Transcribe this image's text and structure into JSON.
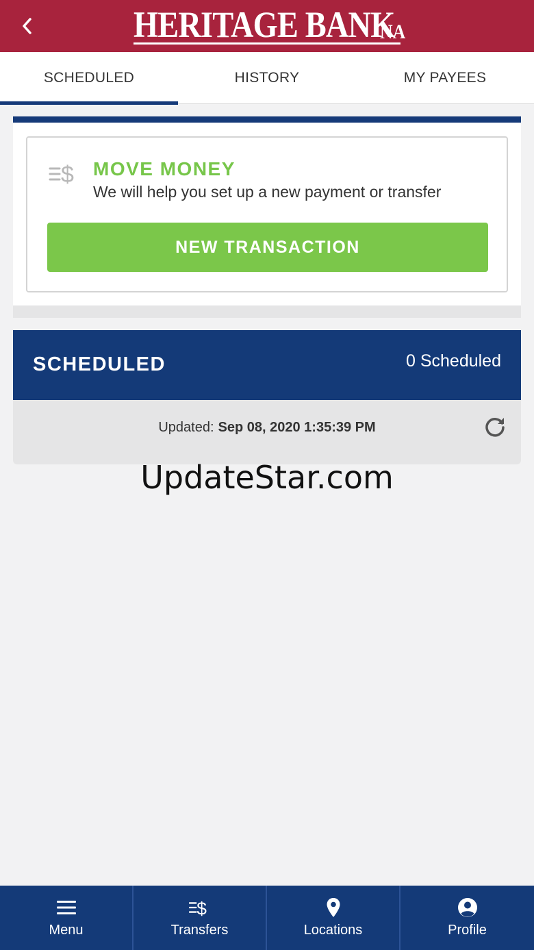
{
  "header": {
    "logo_main": "HERITAGE BANK",
    "logo_suffix": "NA"
  },
  "tabs": [
    {
      "label": "SCHEDULED",
      "active": true
    },
    {
      "label": "HISTORY",
      "active": false
    },
    {
      "label": "MY PAYEES",
      "active": false
    }
  ],
  "move_money": {
    "title": "MOVE MONEY",
    "subtitle": "We will help you set up a new payment or transfer",
    "button_label": "NEW TRANSACTION",
    "icon": "money-transfer-icon"
  },
  "scheduled": {
    "title": "SCHEDULED",
    "count_label": "0 Scheduled",
    "updated_label": "Updated:",
    "updated_value": "Sep 08, 2020 1:35:39 PM"
  },
  "watermark": "UpdateStar.com",
  "bottom_nav": [
    {
      "label": "Menu",
      "icon": "menu-icon"
    },
    {
      "label": "Transfers",
      "icon": "transfers-icon"
    },
    {
      "label": "Locations",
      "icon": "location-pin-icon"
    },
    {
      "label": "Profile",
      "icon": "profile-icon"
    }
  ],
  "colors": {
    "header_red": "#a8233d",
    "navy": "#143a78",
    "green": "#7bc74a",
    "title_green": "#77c64a",
    "background": "#f2f2f3"
  }
}
